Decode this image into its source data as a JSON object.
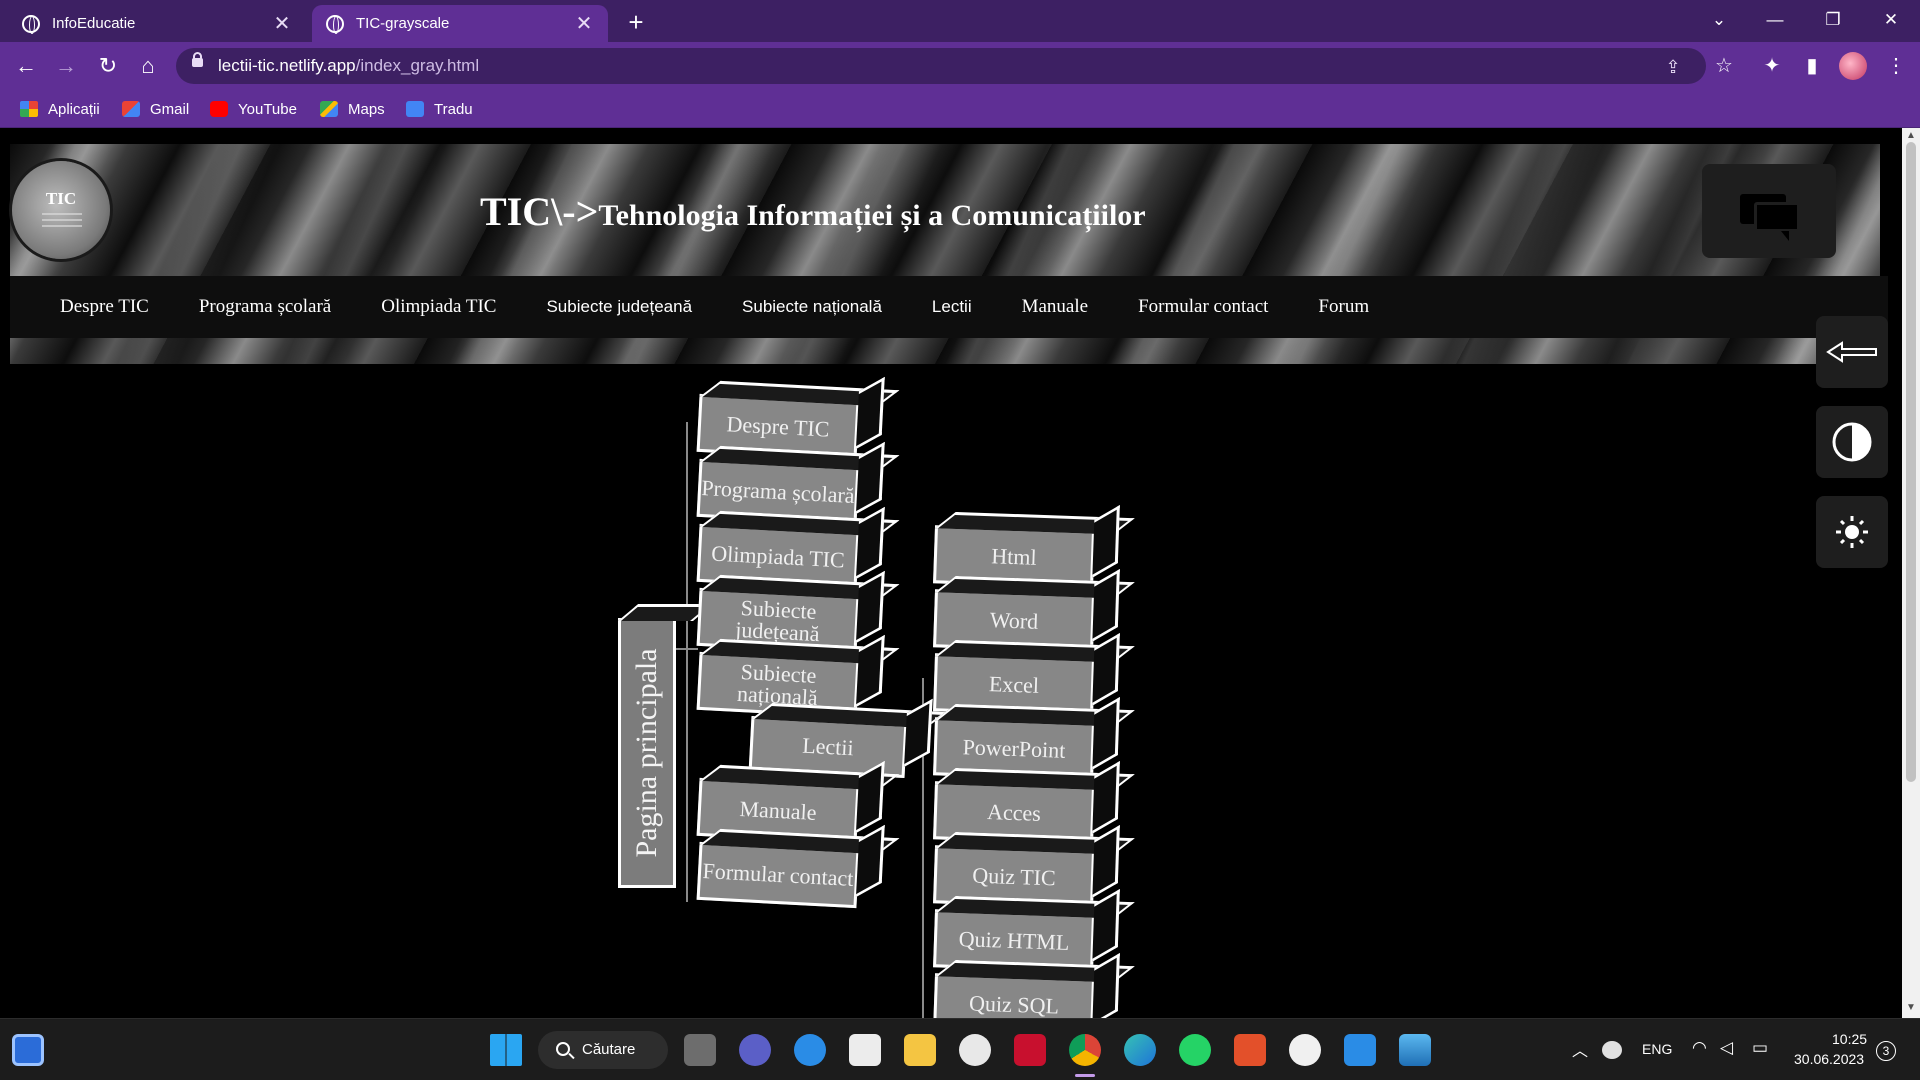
{
  "browser": {
    "tabs": [
      {
        "title": "InfoEducatie",
        "active": false
      },
      {
        "title": "TIC-grayscale",
        "active": true
      }
    ],
    "url_host": "lectii-tic.netlify.app",
    "url_path": "/index_gray.html",
    "bookmarks": [
      "Aplicații",
      "Gmail",
      "YouTube",
      "Maps",
      "Tradu"
    ],
    "theme_color": "#5f2f95"
  },
  "site": {
    "logo_text": "TIC",
    "title_prefix": "TIC\\->",
    "title_rest": "Tehnologia Informației și a Comunicațiilor",
    "nav": [
      "Despre TIC",
      "Programa școlară",
      "Olimpiada TIC",
      "Subiecte județeană",
      "Subiecte națională",
      "Lectii",
      "Manuale",
      "Formular contact",
      "Forum"
    ],
    "side_buttons": [
      "back-arrow-icon",
      "contrast-icon",
      "brightness-icon"
    ]
  },
  "diagram": {
    "root": "Pagina principala",
    "left_column": [
      "Despre TIC",
      "Programa școlară",
      "Olimpiada TIC",
      "Subiecte județeană",
      "Subiecte națională",
      "Lectii",
      "Manuale",
      "Formular contact"
    ],
    "right_column": [
      "Html",
      "Word",
      "Excel",
      "PowerPoint",
      "Acces",
      "Quiz TIC",
      "Quiz HTML",
      "Quiz SQL"
    ]
  },
  "taskbar": {
    "search_label": "Căutare",
    "language": "ENG",
    "time": "10:25",
    "date": "30.06.2023",
    "notifications": "3"
  }
}
